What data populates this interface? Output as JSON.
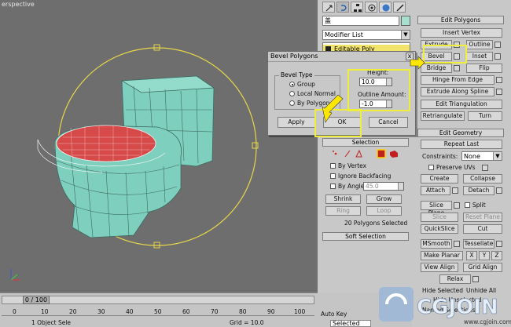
{
  "viewport": {
    "label": "erspective"
  },
  "command_panel": {
    "object_name": "盖",
    "modifier_list": "Modifier List",
    "stack_item": "Editable Poly"
  },
  "edit_polygons": {
    "title": "Edit Polygons",
    "insert_vertex": "Insert Vertex",
    "extrude": "Extrude",
    "outline": "Outline",
    "bevel": "Bevel",
    "inset": "Inset",
    "bridge": "Bridge",
    "flip": "Flip",
    "hinge_from_edge": "Hinge From Edge",
    "extrude_along_spline": "Extrude Along Spline",
    "edit_triangulation": "Edit Triangulation",
    "retriangulate": "Retriangulate",
    "turn": "Turn"
  },
  "edit_geometry": {
    "title": "Edit Geometry",
    "repeat_last": "Repeat Last",
    "constraints_label": "Constraints:",
    "constraints_value": "None",
    "preserve_uvs": "Preserve UVs",
    "create": "Create",
    "collapse": "Collapse",
    "attach": "Attach",
    "detach": "Detach",
    "slice_plane": "Slice Plane",
    "split": "Split",
    "slice": "Slice",
    "reset_plane": "Reset Plane",
    "quickslice": "QuickSlice",
    "cut": "Cut",
    "msmooth": "MSmooth",
    "tessellate": "Tessellate",
    "make_planar": "Make Planar",
    "x": "X",
    "y": "Y",
    "z": "Z",
    "view_align": "View Align",
    "grid_align": "Grid Align",
    "relax": "Relax",
    "hide_selected": "Hide Selected",
    "unhide_all": "Unhide All",
    "hide_unselected": "Hide Unselected",
    "named_selections": "Named Selections:"
  },
  "selection": {
    "title": "Selection",
    "by_vertex": "By Vertex",
    "ignore_backfacing": "Ignore Backfacing",
    "by_angle": "By Angle:",
    "angle_value": "45.0",
    "shrink": "Shrink",
    "grow": "Grow",
    "ring": "Ring",
    "loop": "Loop",
    "status": "20 Polygons Selected",
    "soft_selection": "Soft Selection"
  },
  "bevel_dialog": {
    "title": "Bevel Polygons",
    "close": "x",
    "bevel_type": "Bevel Type",
    "group": "Group",
    "local_normal": "Local Normal",
    "by_polygon": "By Polygon",
    "height_label": "Height:",
    "height_value": "10.0",
    "outline_label": "Outline Amount:",
    "outline_value": "-1.0",
    "apply": "Apply",
    "ok": "OK",
    "cancel": "Cancel"
  },
  "timeline": {
    "frame": "0 / 100",
    "ticks": [
      "0",
      "10",
      "20",
      "30",
      "40",
      "50",
      "60",
      "70",
      "80",
      "90",
      "100"
    ],
    "status_left": "1 Object Sele",
    "grid": "Grid = 10.0",
    "auto_key": "Auto Key",
    "selected": "Selected",
    "set_key": "Set Key",
    "key_filters": "Key Filters..."
  },
  "watermark": {
    "brand": "CG JOIN",
    "url": "www.cgjoin.com"
  },
  "colors": {
    "viewport_bg": "#6e6e6e",
    "mesh_teal": "#7fcfbf",
    "selected_red": "#d64a4a",
    "gizmo_yellow": "#e6d64a",
    "highlight_yellow": "#efee3a"
  }
}
